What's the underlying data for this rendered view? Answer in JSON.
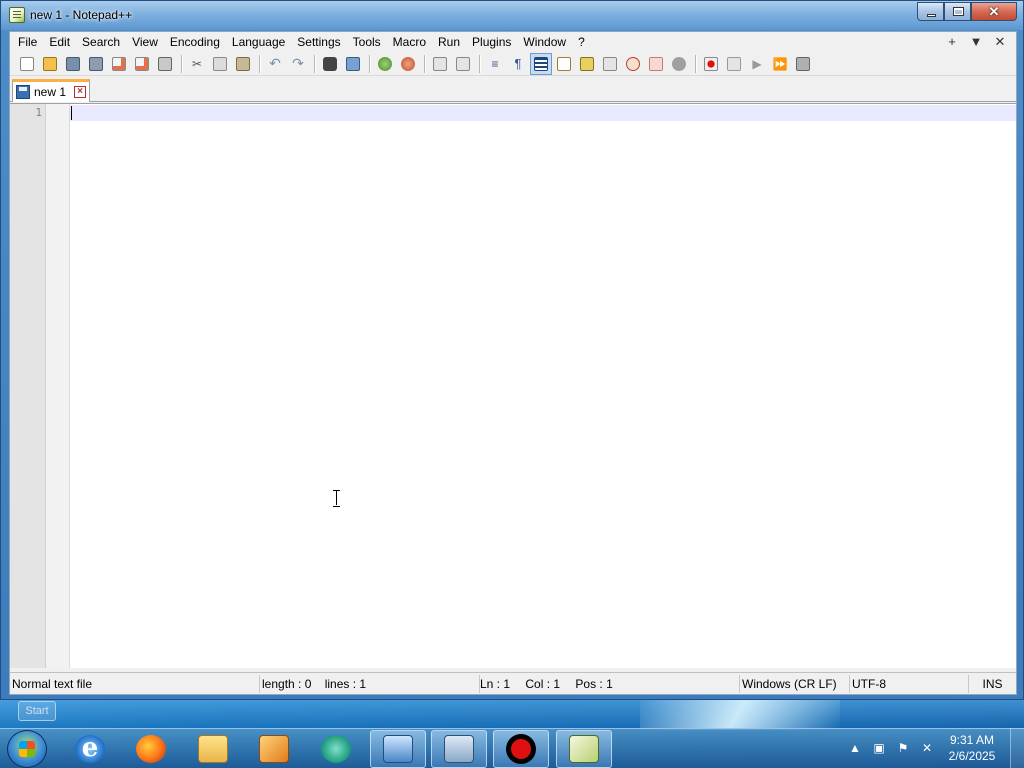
{
  "window": {
    "title": "new 1 - Notepad++"
  },
  "menu": {
    "items": [
      "File",
      "Edit",
      "Search",
      "View",
      "Encoding",
      "Language",
      "Settings",
      "Tools",
      "Macro",
      "Run",
      "Plugins",
      "Window",
      "?"
    ],
    "right": [
      "+",
      "▼",
      "✕"
    ]
  },
  "toolbar": {
    "icons": [
      "new-file-icon",
      "open-file-icon",
      "save-icon",
      "save-all-icon",
      "close-icon",
      "close-all-icon",
      "print-icon",
      "cut-icon",
      "copy-icon",
      "paste-icon",
      "undo-icon",
      "redo-icon",
      "find-icon",
      "replace-icon",
      "zoom-in-icon",
      "zoom-out-icon",
      "sync-vertical-icon",
      "sync-horizontal-icon",
      "word-wrap-icon",
      "show-all-characters-icon",
      "indent-guide-icon",
      "user-defined-language-icon",
      "document-map-icon",
      "function-list-icon",
      "folder-as-workspace-icon",
      "monitoring-icon",
      "spell-check-icon",
      "record-macro-icon",
      "stop-recording-icon",
      "playback-macro-icon",
      "run-macro-multiple-icon",
      "save-macro-icon"
    ]
  },
  "tabs": [
    {
      "label": "new 1"
    }
  ],
  "editor": {
    "line_numbers": [
      "1"
    ]
  },
  "status": {
    "file_type": "Normal text file",
    "length": "length : 0",
    "lines": "lines : 1",
    "ln": "Ln : 1",
    "col": "Col : 1",
    "pos": "Pos : 1",
    "eol": "Windows (CR LF)",
    "encoding": "UTF-8",
    "mode": "INS"
  },
  "desktop": {
    "ghost_button": "Start"
  },
  "taskbar": {
    "time": "9:31 AM",
    "date": "2/6/2025",
    "pinned": [
      "internet-explorer-icon",
      "firefox-icon",
      "file-explorer-icon",
      "media-player-icon",
      "chat-app-icon",
      "remote-desktop-icon",
      "network-icon",
      "recorder-icon",
      "notepadpp-icon"
    ]
  },
  "colors": {
    "tab_accent": "#fab046",
    "current_line": "#e8e8ff",
    "close_button": "#c24a32"
  }
}
